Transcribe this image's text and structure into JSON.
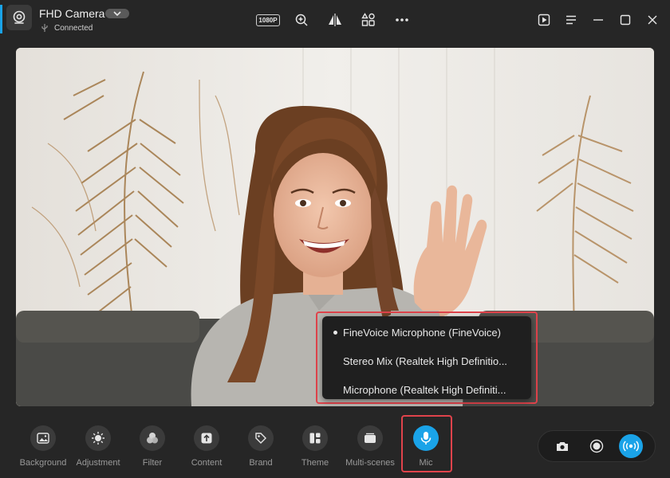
{
  "header": {
    "camera_name": "FHD Camera",
    "status": "Connected",
    "resolution_badge": "1080P"
  },
  "mic_menu": {
    "options": [
      {
        "label": "FineVoice Microphone (FineVoice)",
        "selected": true
      },
      {
        "label": "Stereo Mix (Realtek High Definitio...",
        "selected": false
      },
      {
        "label": "Microphone (Realtek High Definiti...",
        "selected": false
      }
    ]
  },
  "toolbar": {
    "items": [
      {
        "label": "Background",
        "icon": "image-icon"
      },
      {
        "label": "Adjustment",
        "icon": "brightness-icon"
      },
      {
        "label": "Filter",
        "icon": "filter-circles-icon"
      },
      {
        "label": "Content",
        "icon": "upload-icon"
      },
      {
        "label": "Brand",
        "icon": "tag-icon"
      },
      {
        "label": "Theme",
        "icon": "layout-icon"
      },
      {
        "label": "Multi-scenes",
        "icon": "scenes-icon"
      },
      {
        "label": "Mic",
        "icon": "microphone-icon",
        "active": true
      }
    ]
  },
  "colors": {
    "accent": "#1aa3e8",
    "highlight": "#e0434b",
    "background": "#262626"
  }
}
